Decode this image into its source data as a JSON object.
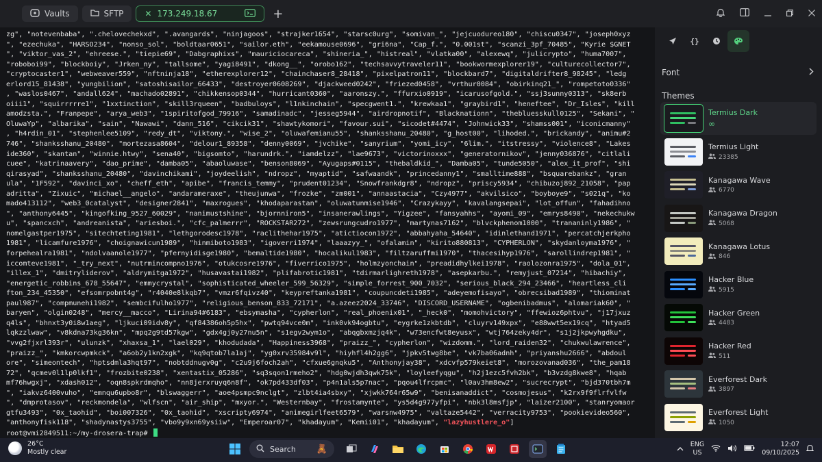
{
  "tabs": [
    {
      "label": "Vaults",
      "icon": "vault-icon"
    },
    {
      "label": "SFTP",
      "icon": "folder-icon"
    },
    {
      "label": "173.249.18.67",
      "icon": "terminal-icon",
      "active": true
    }
  ],
  "terminal": {
    "lines": [
      "zg\", \"notevenbaba\", \".chelovechekxd\", \".avangards\", \"ninjagoos\", \"strajker1654\", \"starsc0urg\", \"somivan_\", \"jejcuodureo180\", \"chiscu0347\", \"joseph0xyz",
      "\", \"ezechuka\", \"HARSO234\", \"nonso_sol\", \"boldtaar0651\", \"sailor.eth\", \"eekamouse0696\", \"gri6na\", \"Cap_f.\", \"0.001st\", \"scanzi_3pf_70485\", \"Kyrie $GNET",
      "\", \"viktor_vas_2\", \"ehreese.\", \"tiepie69\", \"Dabgraphixs\", \"mauriciocareca\", \"shineria_\", \"histreal\", \"vlatka00\", \"alexewq\", \"julicrypto\", \"huma7007\",",
      "\"roboboi99\", \"blockboiy\", \"Jrken_ny\", \"tallsome\", \"yagi8491\", \"dkong__\", \"orobo162\", \"techsavvytraveler11\", \"bookwormexplorer19\", \"culturecollector7\",",
      "\"cryptocaster1\", \"webweaver559\", \"nftninja18\", \"etherexplorer12\", \"chainchaser8_28418\", \"pixelpatron11\", \"blockbard7\", \"digitaldrifter8_98245\", \"ledg",
      "erlord15_81438\", \"yungbilion\", \"satoshisailor_66433\", \"destroyer0608269\", \"djackweed0242\", \"friezed0458\", \"vrthur0084\", \"obirkinq21_\", \"rompetoto0336\"",
      ", \"waslos0467\", \"andall624\", \"machado02891\", \"chikkensop0344\", \"hurricant0360\", \"aaronszy.\", \"ffurxio0919\", \"icarusofgold.\", \"ssj3sunny0313\", \"sk8erb",
      "oiii1\", \"squirrrrre1\", \"1xxtinction\", \"skill3rqueen\", \"badbuloys\", \"l1nkinchain\", \"specgwent1.\", \"krewkaa1\", \"graybird1\", \"heneftee\", \"Dr_Isles\", \"kill",
      "amodzsta.\", \"Franpepe\", \"arya_web3\", \"1spiritofgod_79916\", \"samadinadc\", \"jesseg5944\", \"airdropnotif\", \"Blacknationn\", \"thebluesskull0125\", \"Sekani\", \"",
      "OluwaYp\", \"albarika\", \"sain\", \"Nawawi\", \"dann_516\", \"cikcik31\", \"shawtykomori\", \"favour.sui\", \"sicodet#4474\", \"Johnwick33\", \"shamss001\", \"iconicmanny\"",
      ", \"h4rdin_01\", \"stephenlee5109\", \"redy_dt\", \"viktony.\", \"wise_2\", \"oluwafemianu55\", \"shanksshanu_20480\", \"g_host00\", \"lihoded.\", \"brickandy\", \"animu#2",
      "746\", \"shanksshanu_20480\", \"mortezasa8604\", \"delour1_89358\", \"denny0069\", \"jvchike\", \"sanyrium\", \"yomi_icy\", \"6lim.\", \"itstressy\", \"violence8\", \"Lakes",
      "ide360\", \"skantan\", \"winnie.htwy\", \"sena40\", \"bigsomto\", \"harundrk.\", \"iamdelzz\", \"lae9673\", \"victorinoxxx\", \"generatornikov\", \"jenny036876\", \"citlali",
      "cuee\", \"katrinaavery\", \"dao_prime\", \"damba05\", \"abaoluwase\", \"benson8069\", \"Ayugaps#0115\", \"thebaldkid_\", \"Damba05\", \"tunde5050\", \"alex_it_prof\", \"shi",
      "qirasyad\", \"shanksshanu_20480\", \"davinchikami\", \"joydeelish\", \"ndropz\", \"myaptid\", \"safwaandk\", \"princedanny1\", \"smalltime888\", \"bsquarebankz\", \"gran",
      "ula\", \"1F592\", \"davinci_xo\", \"cheff_eth\", \"apibe\", \"francis_temmy\", \"prudent01234\", \"Snowfrankdgr8\", \"ndropz\", \"priscy5934\", \"chibuzoj892_21058\", \"pap",
      "adritta\", \"Zixuic\", \"michael__angelo\", \"andarameraxe\", \"theujunwa\", \"frozke\", \"zm001\", \"annaastacia\", \"Czy4977\", \"akvilsico\", \"boyboye9\", \"s021q\", \"ko",
      "mado413112\", \"web3_0catalyst\", \"designer2841\", \"maxrogues\", \"khodaparastan\", \"oluwatunmise1946\", \"Crazykayy\", \"kavalangsepai\", \"lot_offun\", \"fahadihno",
      "\", \"anthony6445\", \"kingofking_9527_60029\", \"nanimustshine\", \"bjornniron5\", \"insanerawlings\", \"Yigzee\", \"fansyahhs\", \"ayomi_09\", \"emrys8490\", \"nekechukw",
      "u\", \"spancxch\", \"andreanista\", \"ariesboi.\", \"cfc_palmerrr\", \"ROCKSTAR272\", \"zewsrungcudro1977\", \"martynas7162\", \"blvckphenom1000\", \"trananinly1986\", \"",
      "nomelgastper1975\", \"sitechteting1981\", \"lethgorodesc1978\", \"raclithehar1975\", \"atictiocon1972\", \"abbahyaha_54640\", \"idinlethand1971\", \"percatchjerkpho",
      "1981\", \"licamfure1976\", \"choignawicun1989\", \"hinmiboto1983\", \"igoverri1974\", \"laaazyy_\", \"ofalamin\", \"kirito880813\", \"CYPHERLON\", \"skydanloyma1976\", \"",
      "forpehealra1981\", \"ndolvaanole1977\", \"pfernyidisge1980\", \"bemaltide1980\", \"hocalikul1983\", \"filtzaruffmi1970\", \"thacesihyp1976\", \"sarollindrep1981\", \"",
      "iccomteve1981\", \"_try_next\", \"nutrmincompno1976\", \"otukcosre1976\", \"fiverrico1975\", \"holmzyonchain\", \"preadidhylkei1978\", \"raolozonra1975\", \"dola_01\",",
      "\"illex_1\", \"dmitryliderov\", \"aldrymitga1972\", \"husavastai1982\", \"plifabrotic1981\", \"tdirmarlighreth1978\", \"asepkarbu.\", \"remyjust_07214\", \"hibachiy\",",
      "\"energetic_robbins_678_55647\", \"emmycrystal\", \"sophisticated_wheeler_599_56329\", \"simple_forrest_900_7032\", \"serious_black_294_23466\", \"heartless_cli",
      "fton_234_45350\", \"efsomrpobnt4g\", \"r4040e8lkqb7\", \"vmzr6fqivz40\", \"keypreftanka1981\", \"coupuncdeti1985\", \"adeyemofisayo\", \"obrecsibad1989\", \"thiominat",
      "paul987\", \"compmunehi1982\", \"sembcifulho1977\", \"religious_benson_833_72171\", \"a.azeez2024_33746\", \"DISCORD_USERNAME\", \"ogbenibadmus\", \"alomariak60\", \"",
      "baryen\", \"olgin0248\", \"mercy__macco\", \"Lirina94#6183\", \"ebsymasha\", \"cypherlon\", \"real_phoenix01\", \"_heck0\", \"momohvictory\", \"ffewioz6phtvu\", \"j17jxuz",
      "q4ls\", \"bhnxt3y0i8w1aeg\", \"ljkuci09idv8y\", \"qf84386oh5p5hx\", \"pwtq94vce0m\", \"ink0vk94ogbtu\", \"eygrke1zkbtdb\", \"cluyrv149xpx\", \"e88wwt5ex19cq\", \"htyad5",
      "lqkzzlwaw\", \"v8kdna73kg36kn\", \"mpq2g9td57kgw\", \"gdx4gj0y27nu5n\", \"s1egv2wym1o\", \"abqgbxmzjq4k\", \"w73encfwt8eyusx\", \"wtj764zeky4dr\", \"s1j2jkpwyhgdku\",",
      "\"vvg2fjxrl393r\", \"ulunzk\", \"xhaxsa_1\", \"lael029\", \"khodudada\", \"Happiness3968\", \"praizz_\", \"cypherlon\", \"wizdomm.\", \"lord_raiden32\", \"chukwulawrence\",",
      "\"praizz_\", \"kmkorcwpmkck\", \"a6ob2y1kn2xgk\", \"kq9qtob7la1aj\", \"yg0xrv35984v9l\", \"hiyhfl4h2gg6\", \"jpkv5twg8be\", \"vk7ba06adnh\", \"priyanshu2666\", \"abdoul",
      "ore\", \"simeontech\", \"hptsdmla3hqt97\", \"nobtddnugv0g\", \"c2u9j6foch2ah\", \"cfxue6gnqku5\", \"Anthonyjay38\", \"xdcvfp579keiet8\", \"morozovanad036\", \"the_pam18",
      "72\", \"qcmev0l1lp0lkf1\", \"frozbite0238\", \"xentastix_05286\", \"sq3sqon1rmeho2\", \"hdg0wjdh3qwk75k\", \"loyleefyqgu\", \"h2j1ezc5fvh2bk\", \"b3vzdg8kwe8\", \"hqab",
      "mf76hwgxj\", \"xdash012\", \"oqn8spkrdmqho\", \"nn8jerxruyq6n8f\", \"ok7pd433df03\", \"p4n1als5p7nac\", \"pqou4lfrcpmc\", \"l0av3hm8ew2\", \"sucrecrypt\", \"bjd370tbh7m",
      "\", \"iakvz6400vuho\", \"emnqu6upbo8r\", \"blswaggerr\", \"aoe4psmpc9nclgt\", \"zlbt4ia4sbxy\", \"xjwkk764r65w9\", \"benisanaddict\", \"cosmojesus\", \"k2rx9f9flrfvlfw",
      "\", \"dmprotasov\", \"reckmondela\", \"wlfscn\", \"air_ship\", \"mxyor.\", \"Westernbay\", \"frostamynte\", \"ys5d4g977yfpi\", \"nbk3l8msfjp\", \"laizer2100\", \"stanryomaor",
      "gtfu3493\", \"0x_taohid\", \"boi007326\", \"0x_taohid\", \"xscripty6974\", \"animegirlfeet6579\", \"warsnw4975\", \"valtaze5442\", \"verracity9753\", \"pookievideo560\",",
      "\"anthonyfisk118\", \"shadynastys3755\", \"vbo9y9xn69ysiiw\", \"Emperoar07\", \"khadayum\", \"Kemii01\", \"khadayum\", "
    ],
    "last_line_highlight": "\"lazyhustlere_o\"",
    "last_line_tail": "]",
    "prompt": "root@vmi2849511:~/my-drosera-trap# ",
    "colors": {
      "background": "#141518",
      "text": "#e6e6e6",
      "highlight": "#f2545b",
      "cursor": "#3ddc84"
    }
  },
  "panel": {
    "icons": [
      "rocket-icon",
      "braces-icon",
      "history-icon",
      "palette-icon"
    ],
    "font_label": "Font",
    "themes_label": "Themes",
    "themes": [
      {
        "name": "Termius Dark",
        "meta": "∞",
        "selected": true,
        "bg": "#1a1b1f",
        "c1": "#2fbf62",
        "c2": "#46d879",
        "c3": "#2fbf62",
        "c4": "#7a7b80"
      },
      {
        "name": "Termius Light",
        "meta": "23385",
        "bg": "#f2f3f5",
        "c1": "#5a5c63",
        "c2": "#8b8d93",
        "c3": "#5a5c63",
        "c4": "#3b82f6"
      },
      {
        "name": "Kanagawa Wave",
        "meta": "6770",
        "bg": "#1f1f28",
        "c1": "#c8c093",
        "c2": "#dcd7ba",
        "c3": "#c8c093",
        "c4": "#7e9cd8"
      },
      {
        "name": "Kanagawa Dragon",
        "meta": "5068",
        "bg": "#181616",
        "c1": "#c5c9c5",
        "c2": "#a6a69c",
        "c3": "#c5c9c5",
        "c4": "#8a9a7b"
      },
      {
        "name": "Kanagawa Lotus",
        "meta": "846",
        "bg": "#f2ecbc",
        "c1": "#545464",
        "c2": "#8a8980",
        "c3": "#545464",
        "c4": "#4d699b"
      },
      {
        "name": "Hacker Blue",
        "meta": "5915",
        "bg": "#05070d",
        "c1": "#2b8fff",
        "c2": "#59aaff",
        "c3": "#2b8fff",
        "c4": "#59aaff"
      },
      {
        "name": "Hacker Green",
        "meta": "4483",
        "bg": "#050905",
        "c1": "#22c33a",
        "c2": "#3ee15a",
        "c3": "#22c33a",
        "c4": "#3ee15a"
      },
      {
        "name": "Hacker Red",
        "meta": "511",
        "bg": "#0d0505",
        "c1": "#e0242e",
        "c2": "#ff4d55",
        "c3": "#e0242e",
        "c4": "#ff4d55"
      },
      {
        "name": "Everforest Dark",
        "meta": "3897",
        "bg": "#2d353b",
        "c1": "#d3c6aa",
        "c2": "#a7c080",
        "c3": "#d3c6aa",
        "c4": "#e67e80"
      },
      {
        "name": "Everforest Light",
        "meta": "1050",
        "bg": "#fdf6e3",
        "c1": "#5c6a72",
        "c2": "#8da101",
        "c3": "#5c6a72",
        "c4": "#dfa000"
      }
    ]
  },
  "taskbar": {
    "temperature": "26°C",
    "weather": "Mostly clear",
    "search_label": "Search",
    "lang_top": "ENG",
    "lang_bottom": "US",
    "time": "12:07",
    "date": "09/10/2025"
  }
}
